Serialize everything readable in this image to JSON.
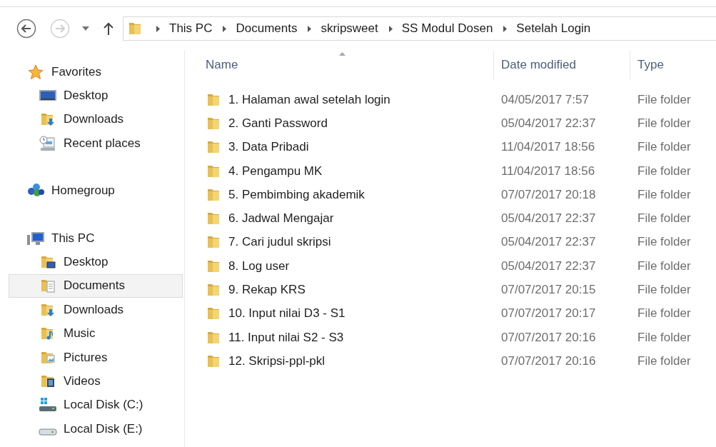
{
  "navigation": {
    "back": {
      "disabled": false
    },
    "forward": {
      "disabled": true
    }
  },
  "address_bar": {
    "path": [
      "This PC",
      "Documents",
      "skripsweet",
      "SS Modul Dosen",
      "Setelah Login"
    ]
  },
  "sidebar": {
    "sections": [
      {
        "label": "Favorites",
        "selected": false,
        "children": [
          {
            "label": "Desktop",
            "selected": false
          },
          {
            "label": "Downloads",
            "selected": false
          },
          {
            "label": "Recent places",
            "selected": false
          }
        ]
      },
      {
        "label": "Homegroup",
        "selected": false
      },
      {
        "label": "This PC",
        "selected": false,
        "children": [
          {
            "label": "Desktop",
            "selected": false
          },
          {
            "label": "Documents",
            "selected": true
          },
          {
            "label": "Downloads",
            "selected": false
          },
          {
            "label": "Music",
            "selected": false
          },
          {
            "label": "Pictures",
            "selected": false
          },
          {
            "label": "Videos",
            "selected": false
          },
          {
            "label": "Local Disk (C:)",
            "selected": false
          },
          {
            "label": "Local Disk (E:)",
            "selected": false
          }
        ]
      }
    ]
  },
  "file_list": {
    "columns": [
      {
        "label": "Name",
        "sorted": true
      },
      {
        "label": "Date modified",
        "sorted": false
      },
      {
        "label": "Type",
        "sorted": false
      }
    ],
    "rows": [
      {
        "name": "1. Halaman awal setelah login",
        "date_modified": "04/05/2017 7:57",
        "type": "File folder"
      },
      {
        "name": "2. Ganti Password",
        "date_modified": "05/04/2017 22:37",
        "type": "File folder"
      },
      {
        "name": "3. Data Pribadi",
        "date_modified": "11/04/2017 18:56",
        "type": "File folder"
      },
      {
        "name": "4. Pengampu MK",
        "date_modified": "11/04/2017 18:56",
        "type": "File folder"
      },
      {
        "name": "5. Pembimbing akademik",
        "date_modified": "07/07/2017 20:18",
        "type": "File folder"
      },
      {
        "name": "6. Jadwal Mengajar",
        "date_modified": "05/04/2017 22:37",
        "type": "File folder"
      },
      {
        "name": "7. Cari judul skripsi",
        "date_modified": "05/04/2017 22:37",
        "type": "File folder"
      },
      {
        "name": "8. Log user",
        "date_modified": "05/04/2017 22:37",
        "type": "File folder"
      },
      {
        "name": "9. Rekap KRS",
        "date_modified": "07/07/2017 20:15",
        "type": "File folder"
      },
      {
        "name": "10. Input nilai D3 - S1",
        "date_modified": "07/07/2017 20:17",
        "type": "File folder"
      },
      {
        "name": "11. Input nilai S2 - S3",
        "date_modified": "07/07/2017 20:16",
        "type": "File folder"
      },
      {
        "name": "12. Skripsi-ppl-pkl",
        "date_modified": "07/07/2017 20:16",
        "type": "File folder"
      }
    ]
  }
}
